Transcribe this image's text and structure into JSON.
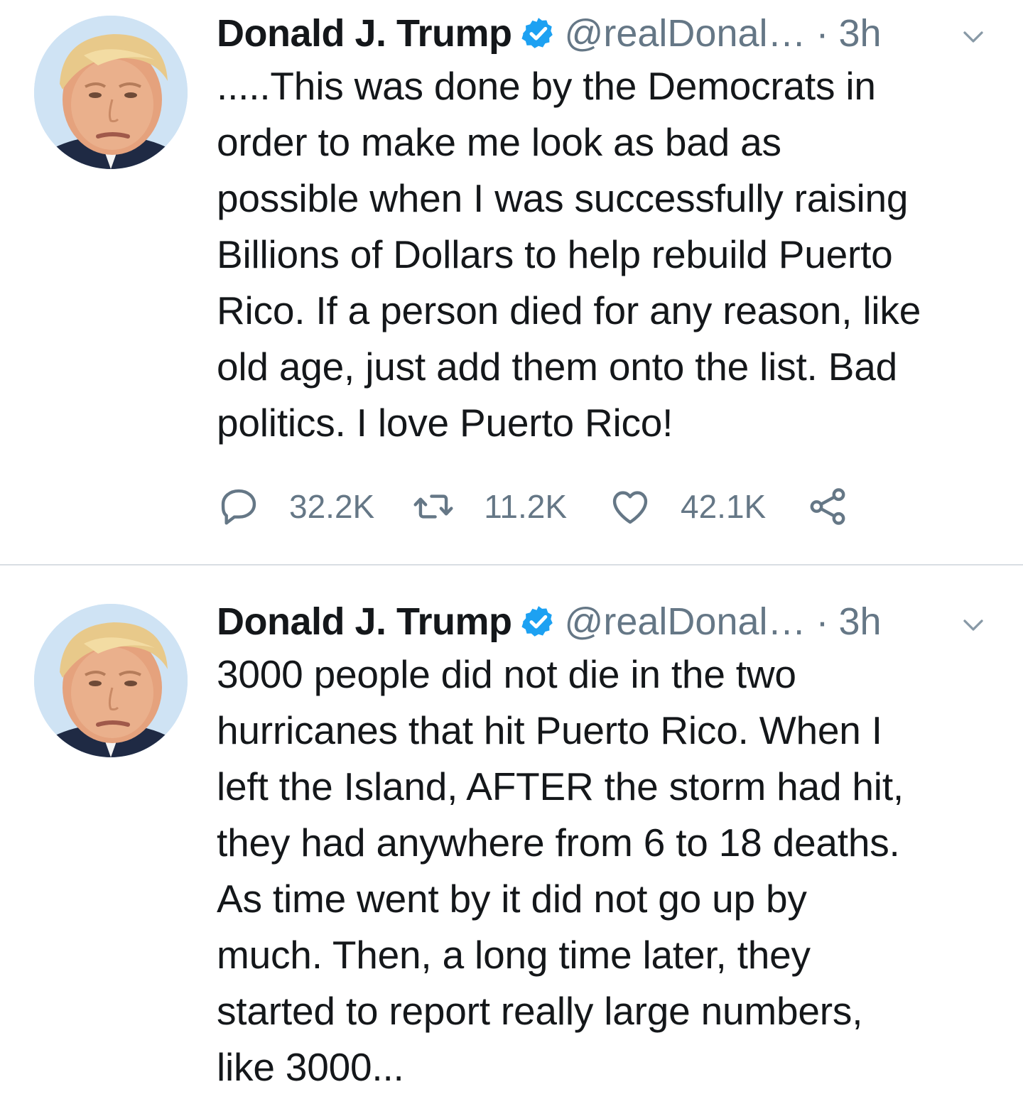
{
  "tweets": [
    {
      "author_name": "Donald J. Trump",
      "handle": "@realDonal…",
      "separator": "·",
      "time": "3h",
      "text": ".....This was done by the Democrats in\norder to make me look as bad as\npossible when I was successfully raising\nBillions of Dollars to help rebuild Puerto\nRico. If a person died for any reason, like\nold age, just add them onto the list. Bad\npolitics. I love Puerto Rico!",
      "replies": "32.2K",
      "retweets": "11.2K",
      "likes": "42.1K"
    },
    {
      "author_name": "Donald J. Trump",
      "handle": "@realDonal…",
      "separator": "·",
      "time": "3h",
      "text": "3000 people did not die in the two\nhurricanes that hit Puerto Rico. When I\nleft the Island, AFTER the storm had hit,\nthey had anywhere from 6 to 18 deaths.\nAs time went by it did not go up by\nmuch. Then, a long time later, they\nstarted to report really large numbers,\nlike 3000..."
    }
  ],
  "icons": {
    "verified": "verified-badge-icon",
    "caret": "chevron-down-icon",
    "reply": "reply-icon",
    "retweet": "retweet-icon",
    "like": "heart-icon",
    "share": "share-icon"
  },
  "colors": {
    "verified_blue": "#1da1f2",
    "secondary_text": "#657786",
    "primary_text": "#14171a",
    "divider": "#d9dee3"
  }
}
